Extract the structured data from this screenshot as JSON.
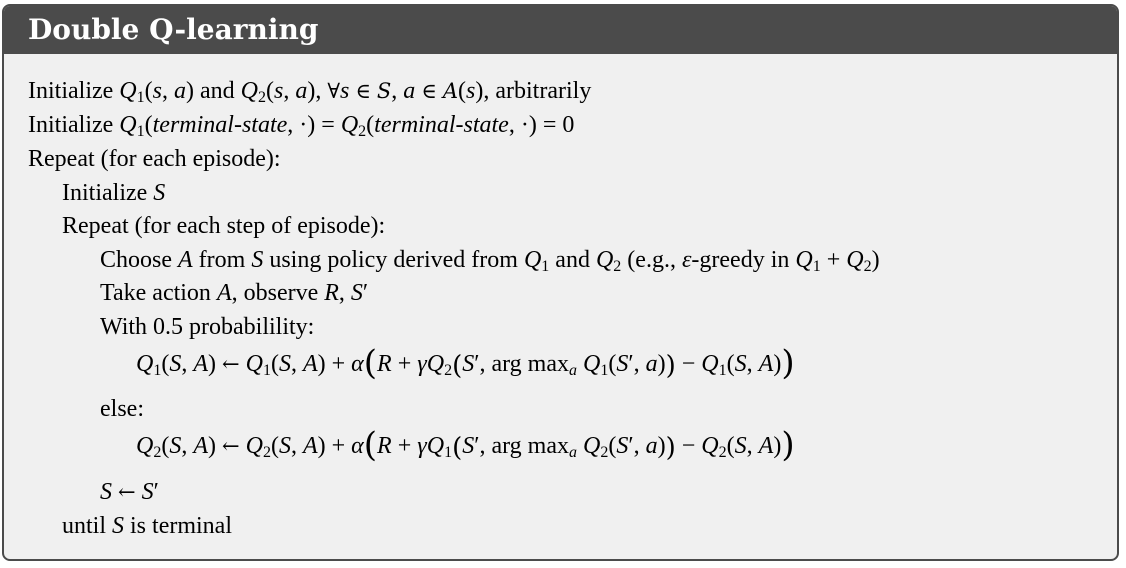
{
  "title": "Double Q-learning",
  "lines": {
    "init1": {
      "prefix": "Initialize ",
      "and": " and ",
      "forall_tail": ", arbitrarily"
    },
    "init2": {
      "prefix": "Initialize ",
      "terminal": "terminal-state",
      "zero": "0"
    },
    "repeat_episode": "Repeat (for each episode):",
    "init_s": {
      "prefix": "Initialize ",
      "var": "S"
    },
    "repeat_step": "Repeat (for each step of episode):",
    "choose": {
      "t1": "Choose ",
      "t2": " from ",
      "t3": " using policy derived from ",
      "t4": " and ",
      "t5": " (e.g., ",
      "t6": "-greedy in ",
      "t7": ")"
    },
    "take": {
      "t1": "Take action ",
      "t2": ", observe ",
      "t3": ", "
    },
    "with_prob": "With 0.5 probabilility:",
    "else": "else:",
    "until": {
      "t1": "until ",
      "t2": " is terminal"
    }
  }
}
